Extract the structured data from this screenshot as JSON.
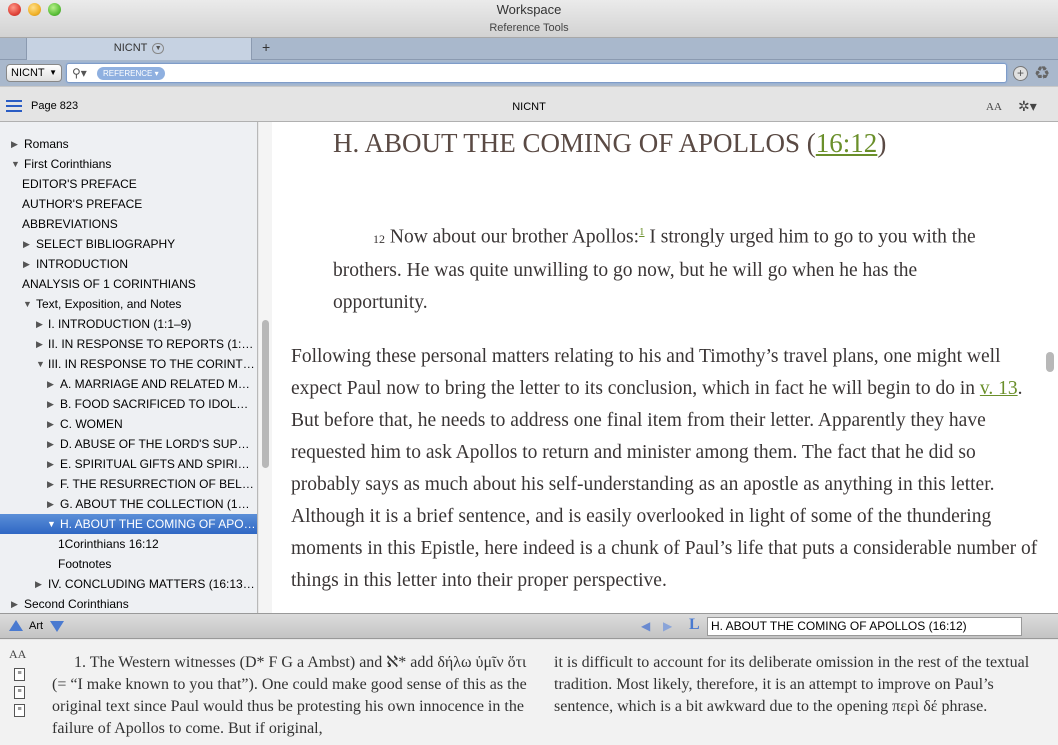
{
  "window": {
    "title": "Workspace",
    "subtitle": "Reference Tools"
  },
  "tabs": [
    {
      "label": "NICNT"
    }
  ],
  "tab_add": "+",
  "search": {
    "resource": "NICNT",
    "pill": "REFERENCE"
  },
  "toolbar": {
    "page": "Page 823",
    "title": "NICNT",
    "font_size_icon": "AA"
  },
  "sidebar": {
    "items": [
      {
        "label": "Romans",
        "tri": "▶"
      },
      {
        "label": "First Corinthians",
        "tri": "▼"
      },
      {
        "label": "EDITOR'S PREFACE",
        "tri": ""
      },
      {
        "label": "AUTHOR'S PREFACE",
        "tri": ""
      },
      {
        "label": "ABBREVIATIONS",
        "tri": ""
      },
      {
        "label": "SELECT BIBLIOGRAPHY",
        "tri": "▶"
      },
      {
        "label": "INTRODUCTION",
        "tri": "▶"
      },
      {
        "label": "ANALYSIS OF 1 CORINTHIANS",
        "tri": ""
      },
      {
        "label": "Text, Exposition, and Notes",
        "tri": "▼"
      },
      {
        "label": "I. INTRODUCTION (1:1–9)",
        "tri": "▶"
      },
      {
        "label": "II. IN RESPONSE TO REPORTS (1:1…",
        "tri": "▶"
      },
      {
        "label": "III. IN RESPONSE TO THE CORINT…",
        "tri": "▼"
      },
      {
        "label": "A. MARRIAGE AND RELATED MA…",
        "tri": "▶"
      },
      {
        "label": "B. FOOD SACRIFICED TO IDOLS…",
        "tri": "▶"
      },
      {
        "label": "C. WOMEN",
        "tri": "▶"
      },
      {
        "label": "D. ABUSE OF THE LORD'S SUPP…",
        "tri": "▶"
      },
      {
        "label": "E. SPIRITUAL GIFTS AND SPIRIT…",
        "tri": "▶"
      },
      {
        "label": "F. THE RESURRECTION OF BELI…",
        "tri": "▶"
      },
      {
        "label": "G. ABOUT THE COLLECTION (16:…",
        "tri": "▶"
      },
      {
        "label": "H. ABOUT THE COMING OF APO…",
        "tri": "▼"
      },
      {
        "label": "1Corinthians  16:12",
        "tri": ""
      },
      {
        "label": "Footnotes",
        "tri": ""
      },
      {
        "label": "IV. CONCLUDING MATTERS (16:13…",
        "tri": "▶"
      },
      {
        "label": "Second Corinthians",
        "tri": "▶"
      }
    ]
  },
  "content": {
    "heading_text": "H. ABOUT THE COMING OF APOLLOS (",
    "heading_ref": "16:12",
    "heading_close": ")",
    "verse_num": "12",
    "verse_text_a": "Now about our brother Apollos:",
    "verse_fn": "1",
    "verse_text_b": " I strongly urged him to go to you with the brothers. He was quite unwilling to go now, but he will go when he has the opportunity.",
    "commentary_a": "Following these personal matters relating to his and Timothy’s travel plans, one might well expect Paul now to bring the letter to its conclusion, which in fact he will begin to do in ",
    "commentary_link": "v. 13",
    "commentary_b": ". But before that, he needs to address one final item from their letter. Apparently they have requested him to ask Apollos to return and minister among them. The fact that he did so probably says as much about his self-understanding as an apostle as anything in this letter. Although it is a brief sentence, and is easily overlooked in light of some of the thundering moments in this Epistle, here indeed is a chunk of Paul’s life that puts a considerable number of things in this letter into their proper perspective."
  },
  "footnote_bar": {
    "label": "Art",
    "location": "H. ABOUT THE COMING OF APOLLOS (16:12)"
  },
  "footnote": {
    "font_size_icon": "AA",
    "col1_num": "1.",
    "col1_text": " The Western witnesses (D* F G a Ambst) and ℵ* add δήλω ὑμῖν ὅτι (= “I make known to you that”). One could make good sense of this as the original text since Paul would thus be protesting his own innocence in the failure of Apollos to come. But if original,",
    "col2_text": "it is difficult to account for its deliberate omission in the rest of the textual tradition. Most likely, therefore, it is an attempt to improve on Paul’s sentence, which is a bit awkward due to the opening περὶ δέ phrase."
  }
}
